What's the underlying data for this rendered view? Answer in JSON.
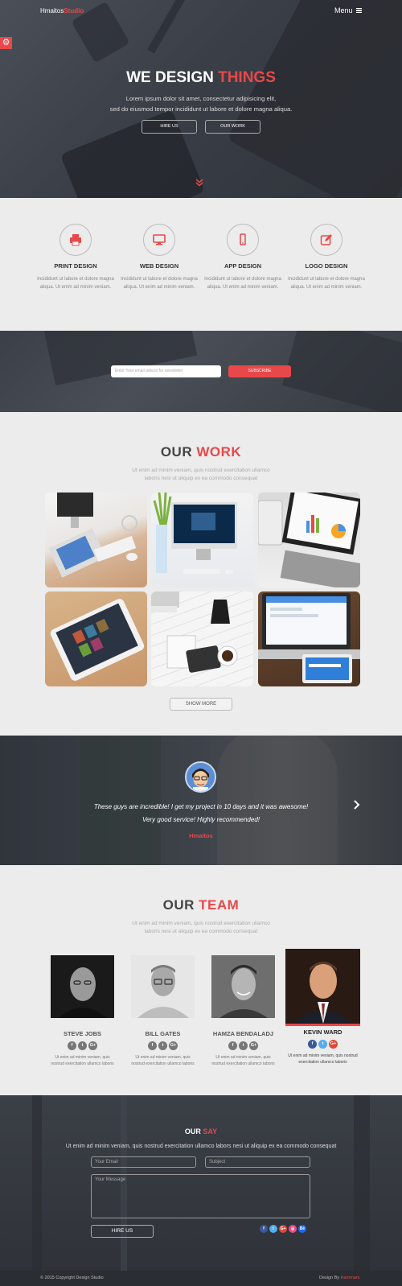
{
  "header": {
    "logo_primary": "Hmaitos",
    "logo_accent": "Studio",
    "menu_label": "Menu"
  },
  "hero": {
    "title_primary": "WE DESIGN",
    "title_accent": "THINGS",
    "subtitle_line1": "Lorem ipsum dolor sit amet, consectetur adipisicing elit,",
    "subtitle_line2": "sed do eiusmod tempor incididunt ut labore et dolore magna aliqua.",
    "buttons": [
      "HIRE US",
      "OUR WORK"
    ]
  },
  "services": [
    {
      "title": "PRINT DESIGN",
      "icon": "printer-icon",
      "desc": "Incididunt ut labore et dolore magna aliqua. Ut enim ad minim veniam."
    },
    {
      "title": "WEB DESIGN",
      "icon": "monitor-icon",
      "desc": "Incididunt ut labore et dolore magna aliqua. Ut enim ad minim veniam."
    },
    {
      "title": "APP DESIGN",
      "icon": "mobile-icon",
      "desc": "Incididunt ut labore et dolore magna aliqua. Ut enim ad minim veniam."
    },
    {
      "title": "LOGO DESIGN",
      "icon": "pencil-square-icon",
      "desc": "Incididunt ut labore et dolore magna aliqua. Ut enim ad minim veniam."
    }
  ],
  "newsletter": {
    "placeholder": "Enter Your email adress for newsletter",
    "button": "SUBSCRIBE"
  },
  "work": {
    "title_primary": "OUR",
    "title_accent": "WORK",
    "subtitle_line1": "Ut enim ad minim veniam, quis nostrud exercitation ullamco",
    "subtitle_line2": "laboris nesi ut aliquip ex ea commodo consequat",
    "show_more": "SHOW MORE"
  },
  "testimonial": {
    "quote_line1": "These guys are incredible! I get my project in 10 days and it was awesome!",
    "quote_line2": "Very good service! Highly recommended!",
    "author": "Hmaitos"
  },
  "team": {
    "title_primary": "OUR",
    "title_accent": "TEAM",
    "subtitle_line1": "Ut enim ad minim veniam, quis nostrud exercitation ullamco",
    "subtitle_line2": "laboris nesi ut aliquip ex ea commodo consequat",
    "members": [
      {
        "name": "STEVE JOBS",
        "desc": "Ut enim ad minim veniam, quis nostrud exercitation ullamco laboris"
      },
      {
        "name": "BILL GATES",
        "desc": "Ut enim ad minim veniam, quis nostrud exercitation ullamco laboris"
      },
      {
        "name": "HAMZA BENDALADJ",
        "desc": "Ut enim ad minim veniam, quis nostrud exercitation ullamco laboris"
      },
      {
        "name": "KEVIN WARD",
        "desc": "Ut enim ad minim veniam, quis nostrud exercitation ullamco laboris"
      }
    ]
  },
  "contact": {
    "title_primary": "OUR",
    "title_accent": "SAY",
    "subtitle": "Ut enim ad minim veniam, quis nostrud exercitation ullamco labors nesi ut aliquip ex ea commodo consequat",
    "email_placeholder": "Your Email",
    "subject_placeholder": "Subject",
    "message_placeholder": "Your Message",
    "button": "HIRE US"
  },
  "footer": {
    "copyright": "© 2015 Copyright Design Studio",
    "design_by": "Design By",
    "design_by_name": "Hammam"
  },
  "colors": {
    "accent": "#e8484a",
    "dark": "#3a3e46",
    "light_bg": "#ececec"
  }
}
